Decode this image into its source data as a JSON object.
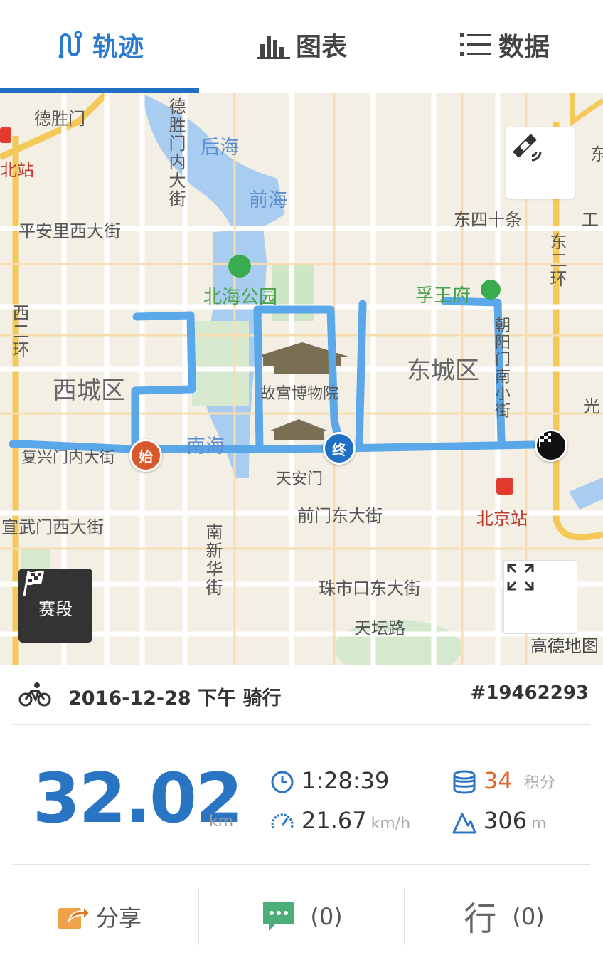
{
  "tabs": [
    {
      "label": "轨迹",
      "icon": "track-icon",
      "active": true
    },
    {
      "label": "图表",
      "icon": "bar-chart-icon",
      "active": false
    },
    {
      "label": "数据",
      "icon": "list-icon",
      "active": false
    }
  ],
  "map": {
    "labels": {
      "deshengmen": "德胜门",
      "beizhan": "北站",
      "deshengmen_nei": "德胜门内大街",
      "houhai": "后海",
      "qianhai": "前海",
      "pinganli": "平安里西大街",
      "dongsi": "东四十条",
      "gong": "工",
      "dongerhuan": "东二环",
      "beihai": "北海公园",
      "xiwangfu": "孚王府",
      "xierhuan": "西二环",
      "xicheng": "西城区",
      "dongcheng": "东城区",
      "gugong": "故宫博物院",
      "chaoyangmen": "朝阳门南小街",
      "guang": "光",
      "nanhai": "南海",
      "fuxingmen": "复兴门内大街",
      "tiananmen": "天安门",
      "qianmen": "前门东大街",
      "beijingzhan": "北京站",
      "xuanwumen": "宣武门西大街",
      "nanxinhua": "南新华街",
      "zhushikou": "珠市口东大街",
      "tiantan": "天坛路",
      "dong": "东"
    },
    "start_marker": "始",
    "end_marker": "终",
    "segment_label": "赛段",
    "credit": "高德地图"
  },
  "activity": {
    "date_line": "2016-12-28 下午 骑行",
    "id": "#19462293",
    "distance": "32.02",
    "distance_unit": "km",
    "duration": "1:28:39",
    "avg_speed": "21.67",
    "speed_unit": "km/h",
    "points": "34",
    "points_label": "积分",
    "elevation": "306",
    "elevation_unit": "m"
  },
  "bottom": {
    "share_label": "分享",
    "comment_count": "(0)",
    "like_glyph": "行",
    "like_count": "(0)"
  },
  "colors": {
    "accent": "#2a7bd1",
    "route": "#5aa7ea",
    "points": "#e0682e"
  }
}
